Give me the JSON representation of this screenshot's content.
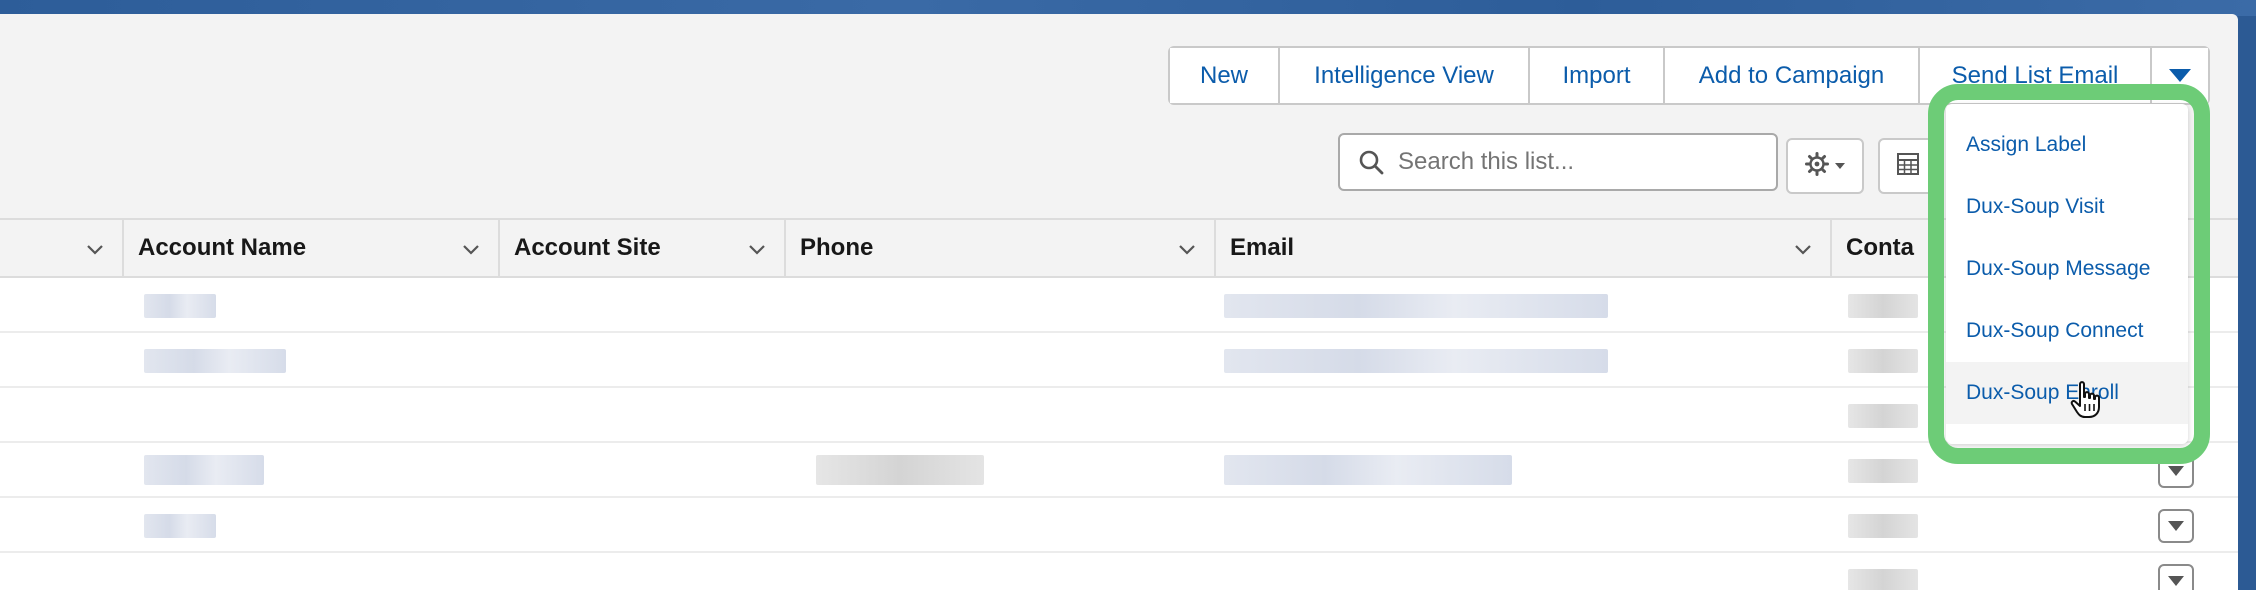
{
  "toolbar": {
    "buttons": [
      "New",
      "Intelligence View",
      "Import",
      "Add to Campaign",
      "Send List Email"
    ],
    "more_icon": "chevron-down-icon"
  },
  "search": {
    "placeholder": "Search this list..."
  },
  "table": {
    "columns": [
      "Account Name",
      "Account Site",
      "Phone",
      "Email",
      "Conta"
    ]
  },
  "menu": {
    "items": [
      "Assign Label",
      "Dux-Soup Visit",
      "Dux-Soup Message",
      "Dux-Soup Connect",
      "Dux-Soup Enroll"
    ],
    "highlight_color": "#6dcc77"
  },
  "colors": {
    "link": "#0b5cab",
    "background_brand": "#2c5a94"
  }
}
